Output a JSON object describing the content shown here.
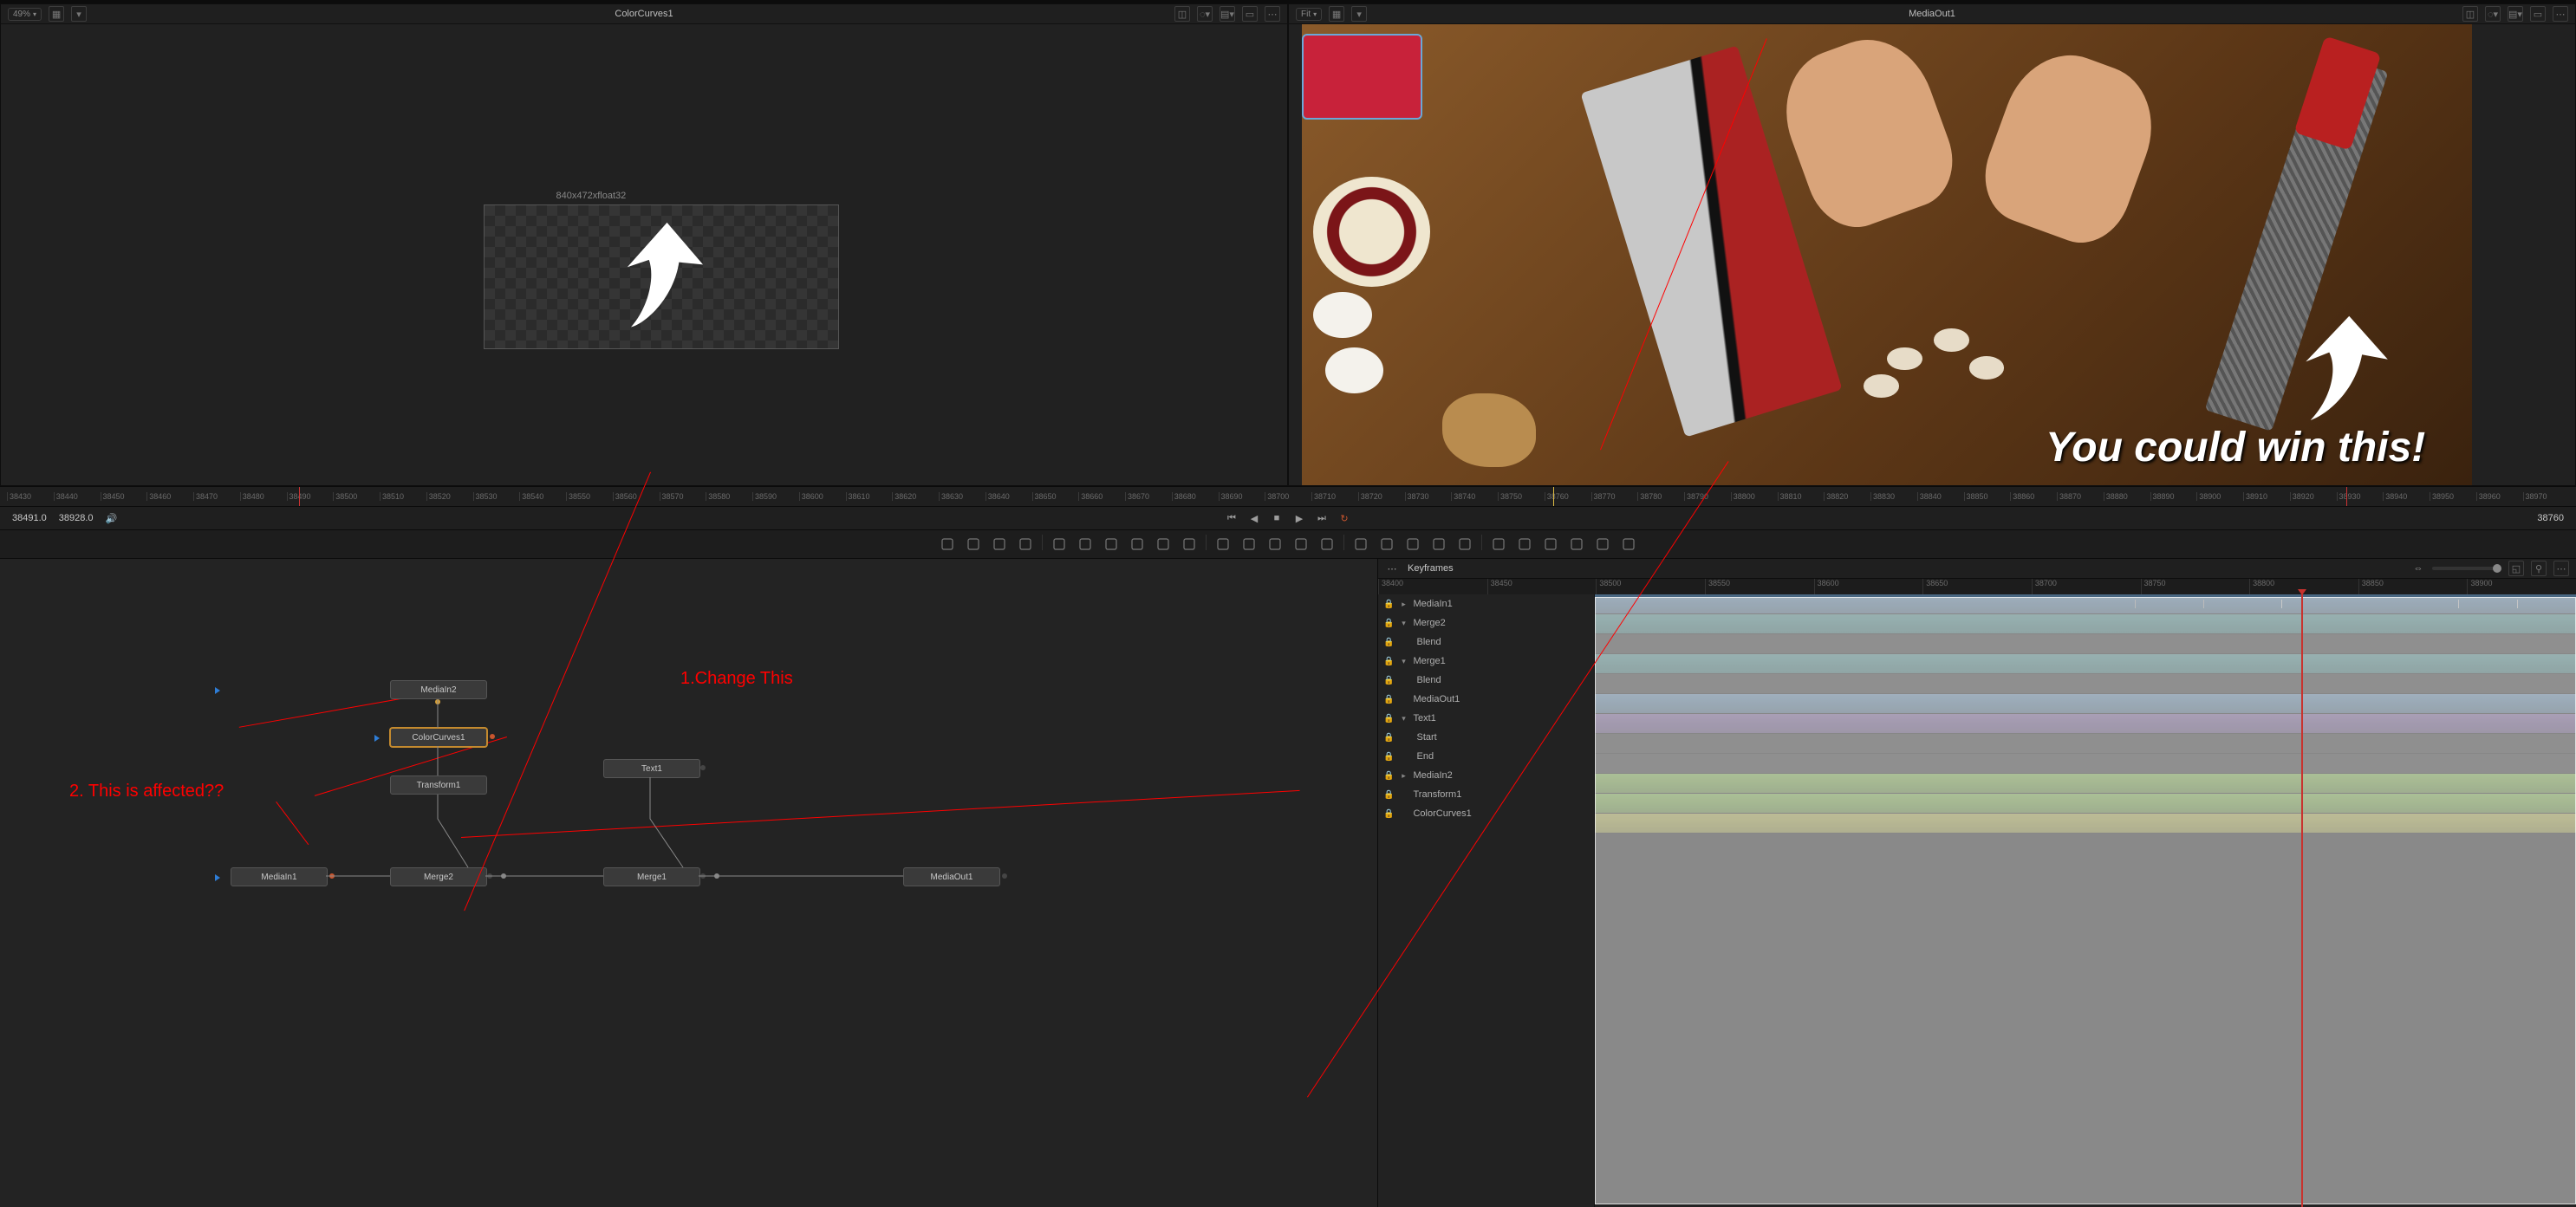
{
  "viewer_left": {
    "title": "ColorCurves1",
    "zoom": "49%",
    "resolution_label": "840x472xfloat32"
  },
  "viewer_right": {
    "title": "MediaOut1",
    "zoom": "Fit",
    "overlay_text": "You could win this!"
  },
  "ruler": {
    "ticks": [
      "38430",
      "38440",
      "38450",
      "38460",
      "38470",
      "38480",
      "38490",
      "38500",
      "38510",
      "38520",
      "38530",
      "38540",
      "38550",
      "38560",
      "38570",
      "38580",
      "38590",
      "38600",
      "38610",
      "38620",
      "38630",
      "38640",
      "38650",
      "38660",
      "38670",
      "38680",
      "38690",
      "38700",
      "38710",
      "38720",
      "38730",
      "38740",
      "38750",
      "38760",
      "38770",
      "38780",
      "38790",
      "38800",
      "38810",
      "38820",
      "38830",
      "38840",
      "38850",
      "38860",
      "38870",
      "38880",
      "38890",
      "38900",
      "38910",
      "38920",
      "38930",
      "38940",
      "38950",
      "38960",
      "38970"
    ]
  },
  "transport": {
    "in_frame": "38491.0",
    "out_frame": "38928.0",
    "current_frame": "38760"
  },
  "annotations": {
    "a1": "1.Change This",
    "a2": "2. This is affected??"
  },
  "nodes": {
    "mediain2": "MediaIn2",
    "colorcurves1": "ColorCurves1",
    "transform1": "Transform1",
    "text1": "Text1",
    "mediain1": "MediaIn1",
    "merge2": "Merge2",
    "merge1": "Merge1",
    "mediaout1": "MediaOut1"
  },
  "keyframes": {
    "panel_title": "Keyframes",
    "ruler": [
      "38400",
      "38450",
      "38500",
      "38550",
      "38600",
      "38650",
      "38700",
      "38750",
      "38800",
      "38850",
      "38900"
    ],
    "tree": [
      {
        "name": "MediaIn1",
        "level": 0,
        "expand": ">"
      },
      {
        "name": "Merge2",
        "level": 0,
        "expand": "v"
      },
      {
        "name": "Blend",
        "level": 1,
        "expand": ""
      },
      {
        "name": "Merge1",
        "level": 0,
        "expand": "v"
      },
      {
        "name": "Blend",
        "level": 1,
        "expand": ""
      },
      {
        "name": "MediaOut1",
        "level": 0,
        "expand": ""
      },
      {
        "name": "Text1",
        "level": 0,
        "expand": "v"
      },
      {
        "name": "Start",
        "level": 1,
        "expand": ""
      },
      {
        "name": "End",
        "level": 1,
        "expand": ""
      },
      {
        "name": "MediaIn2",
        "level": 0,
        "expand": ">"
      },
      {
        "name": "Transform1",
        "level": 0,
        "expand": ""
      },
      {
        "name": "ColorCurves1",
        "level": 0,
        "expand": ""
      }
    ]
  },
  "tools": {
    "row": [
      "media-in",
      "media-out",
      "text",
      "paint",
      "",
      "background",
      "fast-noise",
      "color-corrector",
      "brightness-contrast",
      "blur",
      "drop-shadow",
      "",
      "rectangle",
      "ellipse",
      "polygon",
      "bspline",
      "bitmap",
      "",
      "transform",
      "merge",
      "resize",
      "crop",
      "letterbox",
      "",
      "camera3d",
      "image-plane3d",
      "shape3d",
      "spotlight",
      "renderer3d",
      "merge3d"
    ]
  }
}
